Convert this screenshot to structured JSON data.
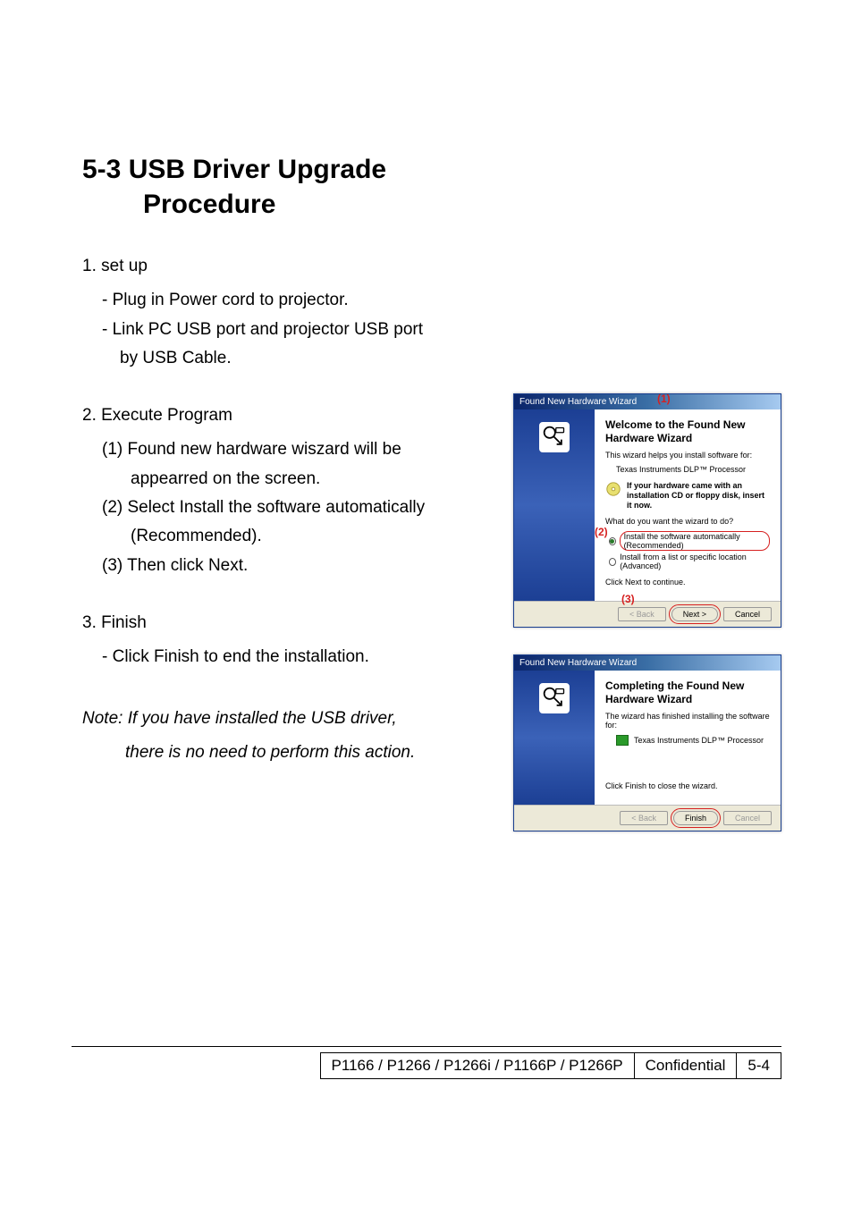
{
  "title": {
    "num": "5-3",
    "line1": "USB Driver Upgrade",
    "line2": "Procedure"
  },
  "steps": {
    "s1": {
      "heading": "1. set up",
      "i1": "-  Plug in Power cord to projector.",
      "i2": "-  Link PC USB port and projector USB port",
      "i2b": "by USB Cable."
    },
    "s2": {
      "heading": "2. Execute Program",
      "i1": "(1)  Found new hardware wiszard will be",
      "i1b": "appearred on the screen.",
      "i2": "(2)  Select Install the software automatically",
      "i2b": "(Recommended).",
      "i3": "(3)  Then click Next."
    },
    "s3": {
      "heading": "3. Finish",
      "i1": "-  Click Finish to end the installation."
    },
    "note1": "Note: If you have installed the USB driver,",
    "note2": "there is no need to perform this action."
  },
  "wizard1": {
    "titlebar": "Found New Hardware Wizard",
    "heading": "Welcome to the Found New Hardware Wizard",
    "p1": "This wizard helps you install software for:",
    "device": "Texas Instruments DLP™ Processor",
    "cd": "If your hardware came with an installation CD or floppy disk, insert it now.",
    "q": "What do you want the wizard to do?",
    "opt1": "Install the software automatically (Recommended)",
    "opt2": "Install from a list or specific location (Advanced)",
    "cont": "Click Next to continue.",
    "back": "< Back",
    "next": "Next >",
    "cancel": "Cancel",
    "ann1": "(1)",
    "ann2": "(2)",
    "ann3": "(3)"
  },
  "wizard2": {
    "titlebar": "Found New Hardware Wizard",
    "heading": "Completing the Found New Hardware Wizard",
    "p1": "The wizard has finished installing the software for:",
    "device": "Texas Instruments DLP™ Processor",
    "cont": "Click Finish to close the wizard.",
    "back": "< Back",
    "finish": "Finish",
    "cancel": "Cancel"
  },
  "footer": {
    "models": "P1166 / P1266 / P1266i / P1166P / P1266P",
    "conf": "Confidential",
    "page": "5-4"
  }
}
